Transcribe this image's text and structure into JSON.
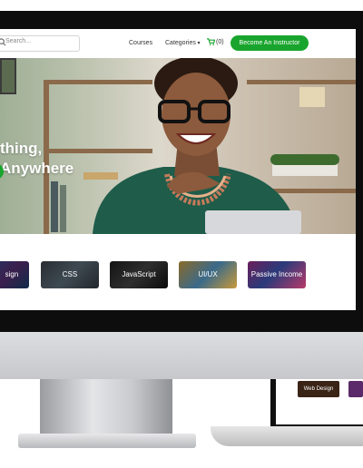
{
  "nav": {
    "search_placeholder": "Search...",
    "courses": "Courses",
    "categories": "Categories",
    "cart_count": "(0)",
    "cta": "Become An Instructor"
  },
  "hero": {
    "title_line1": "thing,",
    "title_line2": "Anywhere"
  },
  "categories": [
    "sign",
    "CSS",
    "JavaScript",
    "UI/UX",
    "Passive Income"
  ],
  "laptop": {
    "card1": "Web Design"
  },
  "colors": {
    "accent": "#19a52d",
    "bezel": "#0d0d0d"
  }
}
